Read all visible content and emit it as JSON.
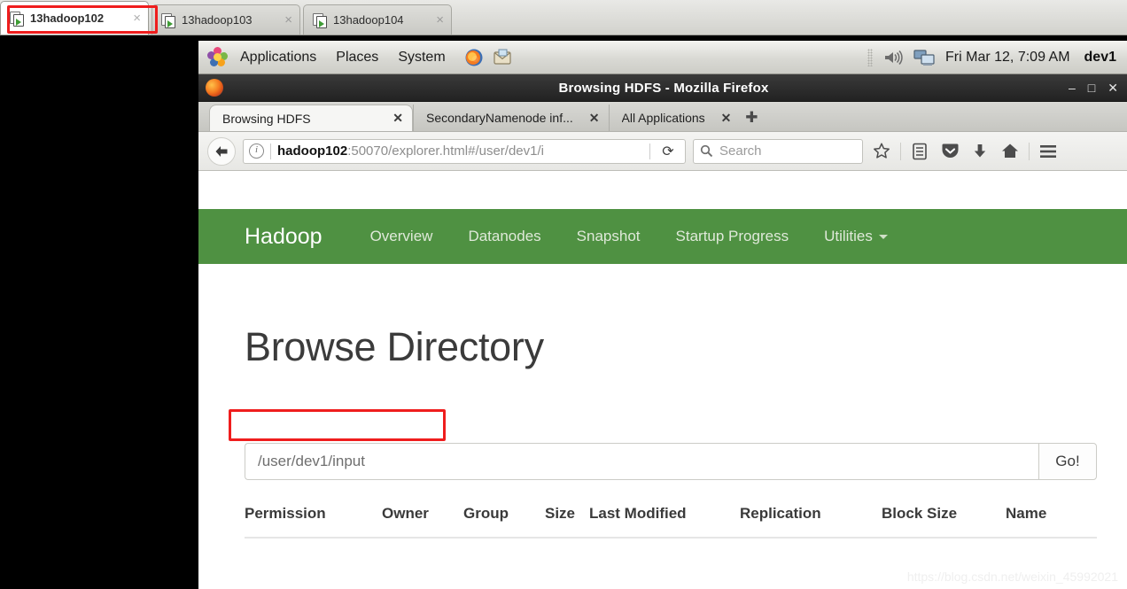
{
  "terminal_tabs": [
    {
      "label": "13hadoop102",
      "active": true,
      "icon": "terminal-session-icon",
      "close": "×"
    },
    {
      "label": "13hadoop103",
      "active": false,
      "icon": "terminal-session-icon",
      "close": "×"
    },
    {
      "label": "13hadoop104",
      "active": false,
      "icon": "terminal-session-icon",
      "close": "×"
    }
  ],
  "gnome_panel": {
    "menus": [
      "Applications",
      "Places",
      "System"
    ],
    "launchers": [
      "firefox-icon",
      "mail-icon"
    ],
    "tray": [
      "volume-icon",
      "network-monitor-icon"
    ],
    "clock": "Fri Mar 12, 7:09 AM",
    "user": "dev1"
  },
  "firefox": {
    "window_title": "Browsing HDFS - Mozilla Firefox",
    "window_buttons": {
      "minimize": "–",
      "maximize": "□",
      "close": "✕"
    },
    "tabs": [
      {
        "title": "Browsing HDFS",
        "active": true,
        "close": "✕"
      },
      {
        "title": "SecondaryNamenode inf...",
        "active": false,
        "close": "✕"
      },
      {
        "title": "All Applications",
        "active": false,
        "close": "✕"
      }
    ],
    "new_tab_label": "✚",
    "back_arrow": "←",
    "url_host": "hadoop102",
    "url_rest": ":50070/explorer.html#/user/dev1/i",
    "reload_label": "⟳",
    "search_placeholder": "Search",
    "toolbar_icons": [
      "bookmark-star-icon",
      "library-icon",
      "pocket-icon",
      "downloads-icon",
      "home-icon",
      "menu-icon"
    ]
  },
  "hadoop": {
    "brand": "Hadoop",
    "nav_links": [
      "Overview",
      "Datanodes",
      "Snapshot",
      "Startup Progress",
      "Utilities"
    ],
    "page_title": "Browse Directory",
    "path_value": "/user/dev1/input",
    "path_placeholder": "/user/dev1/input",
    "go_label": "Go!",
    "table_headers": [
      "Permission",
      "Owner",
      "Group",
      "Size",
      "Last Modified",
      "Replication",
      "Block Size",
      "Name"
    ],
    "table_rows": []
  },
  "watermark": "https://blog.csdn.net/weixin_45992021",
  "colors": {
    "hadoop_green": "#4f9142",
    "annotation_red": "#ef1d1d",
    "panel_gray": "#d9d9d4",
    "titlebar_dark": "#2b2b2b"
  }
}
